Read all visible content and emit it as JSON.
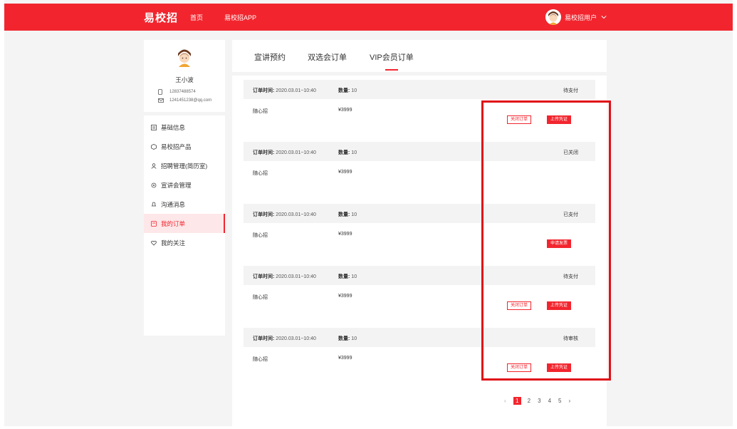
{
  "header": {
    "logo": "易校招",
    "nav": [
      "首页",
      "易校招APP"
    ],
    "user_name": "易校招用户"
  },
  "profile": {
    "name": "王小波",
    "phone": "12837488574",
    "email": "1241451238@qq.com"
  },
  "menu": [
    {
      "label": "基础信息",
      "icon": "document-icon"
    },
    {
      "label": "易校招产品",
      "icon": "box-icon"
    },
    {
      "label": "招聘管理(简历室)",
      "icon": "person-icon"
    },
    {
      "label": "宣讲会管理",
      "icon": "presentation-icon"
    },
    {
      "label": "沟通消息",
      "icon": "bell-icon"
    },
    {
      "label": "我的订单",
      "icon": "order-icon",
      "active": true
    },
    {
      "label": "我的关注",
      "icon": "heart-icon"
    }
  ],
  "tabs": [
    "宣讲预约",
    "双选会订单",
    "VIP会员订单"
  ],
  "orders": [
    {
      "time_label": "订单时间:",
      "time": "2020.03.01~10:40",
      "qty_label": "数量:",
      "qty": "10",
      "status": "待支付",
      "name": "随心招",
      "price": "¥3999",
      "close_btn": "关闭订单",
      "upload_btn": "上传凭证"
    },
    {
      "time_label": "订单时间:",
      "time": "2020.03.01~10:40",
      "qty_label": "数量:",
      "qty": "10",
      "status": "已关闭",
      "name": "随心招",
      "price": "¥3999"
    },
    {
      "time_label": "订单时间:",
      "time": "2020.03.01~10:40",
      "qty_label": "数量:",
      "qty": "10",
      "status": "已支付",
      "name": "随心招",
      "price": "¥3999",
      "invoice_btn": "申请发票"
    },
    {
      "time_label": "订单时间:",
      "time": "2020.03.01~10:40",
      "qty_label": "数量:",
      "qty": "10",
      "status": "待支付",
      "name": "随心招",
      "price": "¥3999",
      "close_btn": "关闭订单",
      "upload_btn": "上传凭证"
    },
    {
      "time_label": "订单时间:",
      "time": "2020.03.01~10:40",
      "qty_label": "数量:",
      "qty": "10",
      "status": "待审核",
      "name": "随心招",
      "price": "¥3999",
      "close_btn": "关闭订单",
      "upload_btn": "上传凭证"
    }
  ],
  "pagination": {
    "prev": "‹",
    "pages": [
      "1",
      "2",
      "3",
      "4",
      "5"
    ],
    "next": "›",
    "current": "1"
  },
  "colors": {
    "accent": "#f2252e",
    "highlight": "#e01018"
  }
}
